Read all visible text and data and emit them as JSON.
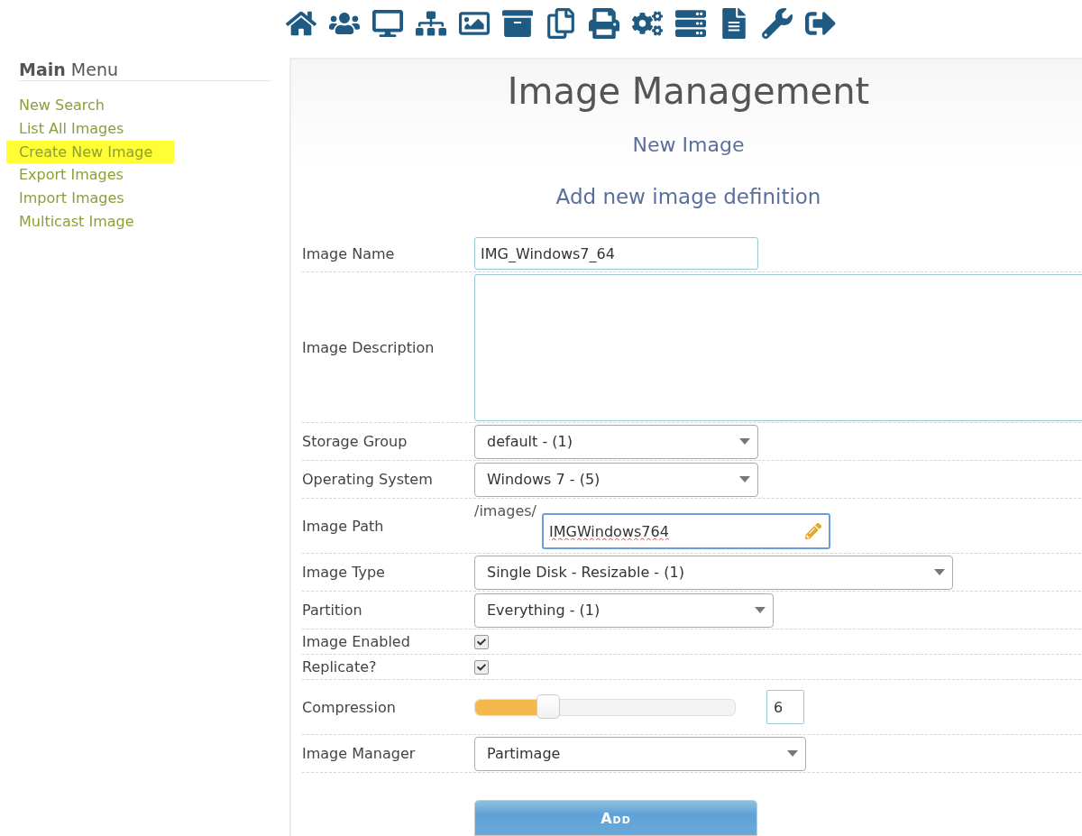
{
  "toolbar": [
    {
      "kind": "home"
    },
    {
      "kind": "users"
    },
    {
      "kind": "desktop"
    },
    {
      "kind": "sitemap"
    },
    {
      "kind": "image"
    },
    {
      "kind": "archive"
    },
    {
      "kind": "copy"
    },
    {
      "kind": "print"
    },
    {
      "kind": "cogs"
    },
    {
      "kind": "server"
    },
    {
      "kind": "file"
    },
    {
      "kind": "wrench"
    },
    {
      "kind": "signout"
    }
  ],
  "sidebar": {
    "title_bold": "Main",
    "title_rest": "Menu",
    "items": [
      {
        "label": "New Search",
        "highlighted": false
      },
      {
        "label": "List All Images",
        "highlighted": false
      },
      {
        "label": "Create New Image",
        "highlighted": true
      },
      {
        "label": "Export Images",
        "highlighted": false
      },
      {
        "label": "Import Images",
        "highlighted": false
      },
      {
        "label": "Multicast Image",
        "highlighted": false
      }
    ]
  },
  "page": {
    "title": "Image Management",
    "subtitle": "New Image",
    "form_title": "Add new image definition"
  },
  "form": [
    {
      "kind": "text",
      "label": "Image Name",
      "value": "IMG_Windows7_64"
    },
    {
      "kind": "textarea",
      "label": "Image Description"
    },
    {
      "kind": "select",
      "label": "Storage Group",
      "value": "default - (1)"
    },
    {
      "kind": "select",
      "label": "Operating System",
      "value": "Windows 7 - (5)"
    },
    {
      "kind": "path",
      "label": "Image Path",
      "prefix": "/images/",
      "value": "IMGWindows764",
      "focused": true
    },
    {
      "kind": "select",
      "label": "Image Type",
      "value": "Single Disk - Resizable - (1)"
    },
    {
      "kind": "select",
      "label": "Partition",
      "value": "Everything - (1)"
    },
    {
      "kind": "checkbox",
      "label": "Image Enabled",
      "checked": true
    },
    {
      "kind": "checkbox",
      "label": "Replicate?",
      "checked": true
    },
    {
      "kind": "slider",
      "label": "Compression",
      "level": 0.28,
      "value": "6"
    },
    {
      "kind": "select",
      "label": "Image Manager",
      "value": "Partimage"
    }
  ],
  "submit": "Add"
}
